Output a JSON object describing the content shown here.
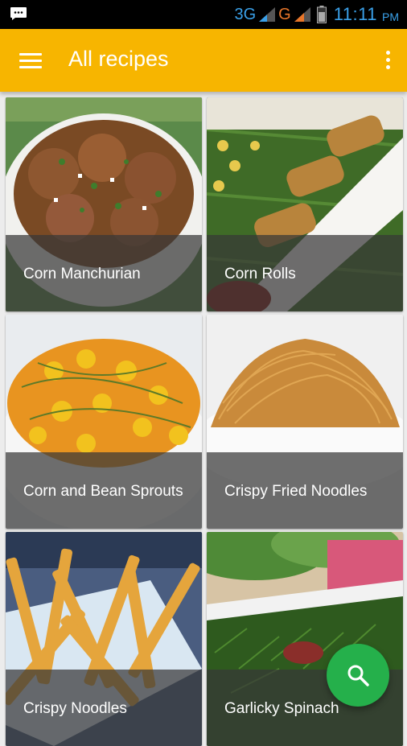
{
  "status_bar": {
    "network_1": "3G",
    "network_2": "G",
    "time": "11:11",
    "ampm": "PM",
    "icons": [
      "message-icon",
      "signal-icon",
      "battery-icon"
    ]
  },
  "app_bar": {
    "title": "All recipes",
    "color": "#f7b500",
    "icons": [
      "menu-icon",
      "more-vert-icon"
    ]
  },
  "recipes": [
    {
      "name": "Corn Manchurian"
    },
    {
      "name": "Corn Rolls"
    },
    {
      "name": "Corn and Bean Sprouts"
    },
    {
      "name": "Crispy Fried Noodles"
    },
    {
      "name": "Crispy Noodles"
    },
    {
      "name": "Garlicky Spinach"
    }
  ],
  "fab": {
    "icon": "search-icon",
    "color": "#25b04b"
  }
}
